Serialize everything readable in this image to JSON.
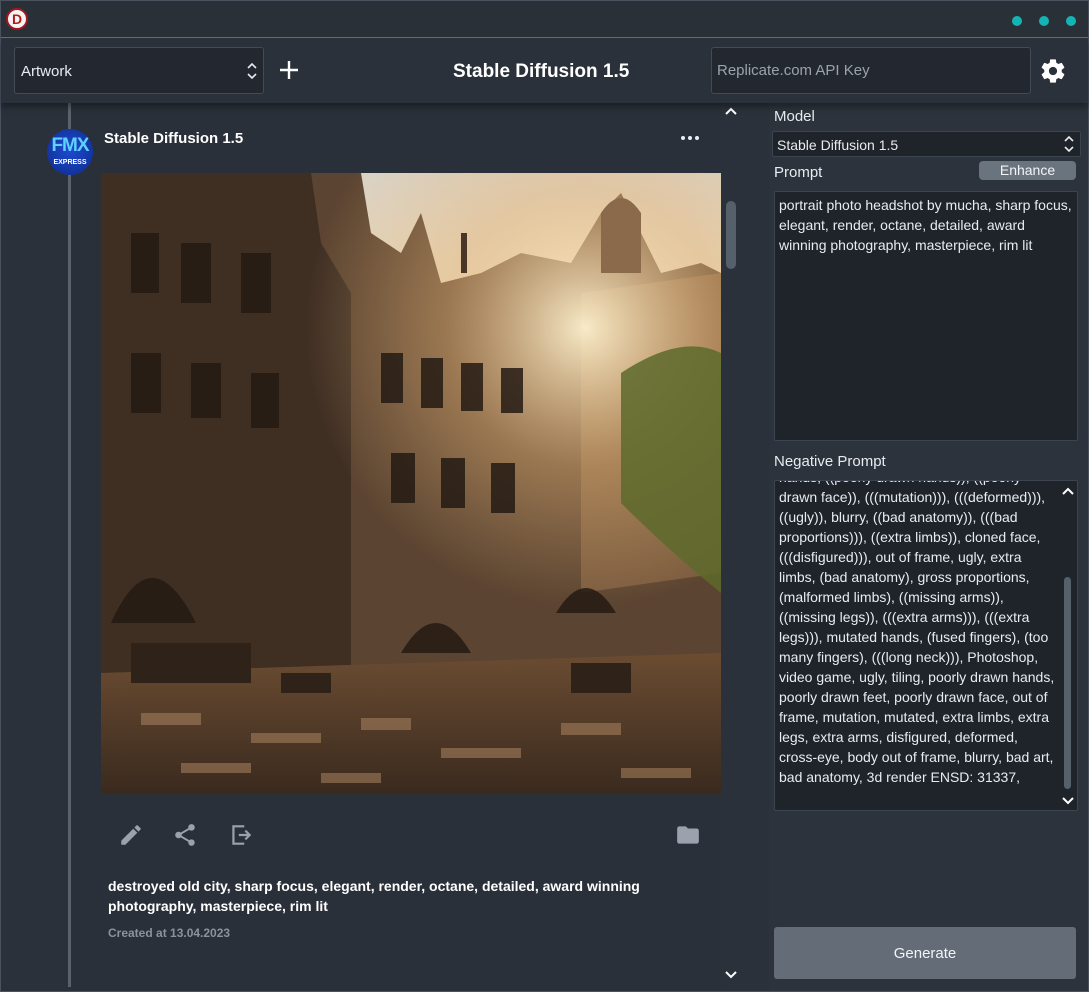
{
  "app": {
    "logo_letter": "D"
  },
  "toolbar": {
    "category_value": "Artwork",
    "title": "Stable Diffusion 1.5",
    "api_key_placeholder": "Replicate.com API Key"
  },
  "post": {
    "author": "Stable Diffusion 1.5",
    "avatar_text": "FMX",
    "avatar_subtext": "EXPRESS",
    "caption": "destroyed old city, sharp focus, elegant, render, octane, detailed, award winning photography, masterpiece, rim lit",
    "created": "Created at 13.04.2023",
    "actions": [
      "edit-icon",
      "share-icon",
      "export-icon",
      "folder-icon"
    ]
  },
  "settings": {
    "model_label": "Model",
    "model_value": "Stable Diffusion 1.5",
    "prompt_label": "Prompt",
    "enhance_label": "Enhance",
    "prompt_text": "portrait photo headshot by mucha, sharp focus, elegant, render, octane, detailed, award winning photography, masterpiece, rim lit",
    "negative_label": "Negative Prompt",
    "negative_text": "hands, ((poorly drawn hands)), ((poorly drawn face)), (((mutation))), (((deformed))), ((ugly)), blurry, ((bad anatomy)), (((bad proportions))), ((extra limbs)), cloned face, (((disfigured))), out of frame, ugly, extra limbs, (bad anatomy), gross proportions, (malformed limbs), ((missing arms)), ((missing legs)), (((extra arms))), (((extra legs))), mutated hands, (fused fingers), (too many fingers), (((long neck))), Photoshop, video game, ugly, tiling, poorly drawn hands, poorly drawn feet, poorly drawn face, out of frame, mutation, mutated, extra limbs, extra legs, extra arms, disfigured, deformed, cross-eye, body out of frame, blurry, bad art, bad anatomy, 3d render ENSD: 31337,",
    "generate_label": "Generate"
  },
  "colors": {
    "accent": "#15b4b4",
    "background": "#2d333c",
    "input_bg": "#1f242b"
  }
}
